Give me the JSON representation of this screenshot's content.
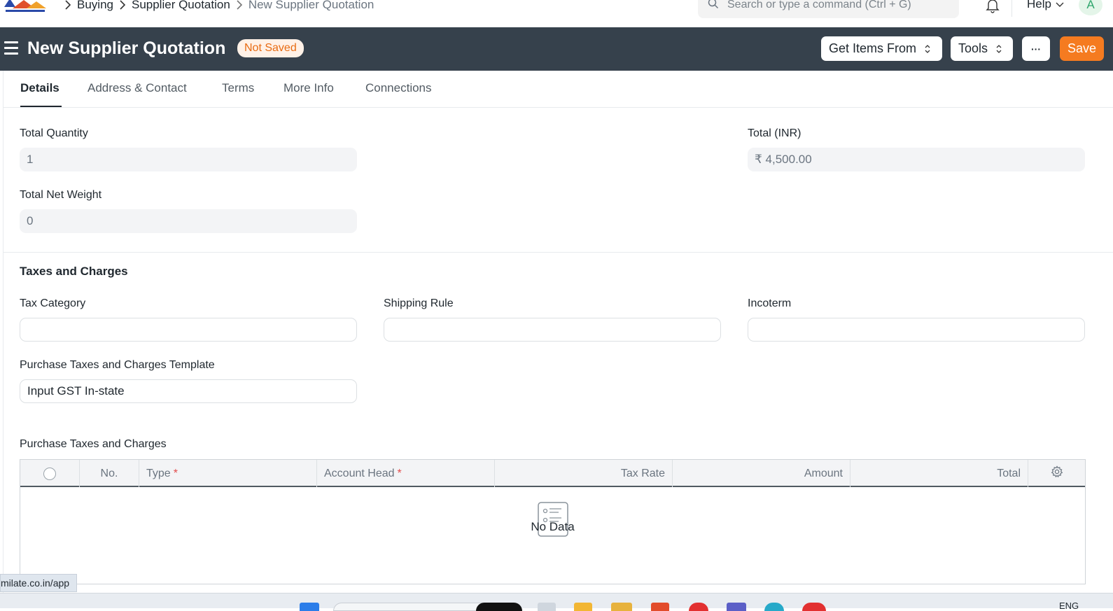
{
  "navbar": {
    "breadcrumbs": [
      "Buying",
      "Supplier Quotation",
      "New Supplier Quotation"
    ],
    "search_placeholder": "Search or type a command (Ctrl + G)",
    "help_label": "Help",
    "avatar_initial": "A"
  },
  "header": {
    "title": "New Supplier Quotation",
    "status_badge": "Not Saved",
    "get_items_label": "Get Items From",
    "tools_label": "Tools",
    "more_label": "···",
    "save_label": "Save"
  },
  "tabs": [
    "Details",
    "Address & Contact",
    "Terms",
    "More Info",
    "Connections"
  ],
  "totals": {
    "total_quantity_label": "Total Quantity",
    "total_quantity_value": "1",
    "total_net_weight_label": "Total Net Weight",
    "total_net_weight_value": "0",
    "total_inr_label": "Total (INR)",
    "total_inr_value": "₹ 4,500.00"
  },
  "taxes": {
    "section_title": "Taxes and Charges",
    "tax_category_label": "Tax Category",
    "tax_category_value": "",
    "shipping_rule_label": "Shipping Rule",
    "shipping_rule_value": "",
    "incoterm_label": "Incoterm",
    "incoterm_value": "",
    "template_label": "Purchase Taxes and Charges Template",
    "template_value": "Input GST In-state",
    "table_label": "Purchase Taxes and Charges",
    "columns": [
      "No.",
      "Type",
      "Account Head",
      "Tax Rate",
      "Amount",
      "Total"
    ],
    "empty_text": "No Data"
  },
  "status_bar": {
    "url": "milate.co.in/app"
  },
  "taskbar": {
    "language": "ENG"
  },
  "colors": {
    "header_bg": "#36414c",
    "save_button": "#f57b20",
    "badge_text": "#e86c13",
    "badge_bg": "#fff1e7"
  }
}
